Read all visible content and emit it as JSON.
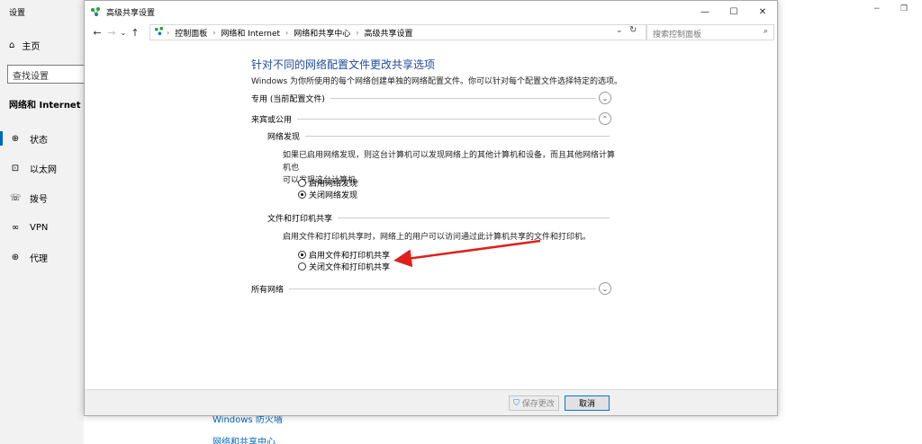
{
  "settings": {
    "title": "设置",
    "home_label": "主页",
    "search_placeholder": "查找设置",
    "section_title": "网络和 Internet",
    "nav": [
      {
        "label": "状态",
        "icon": "status-icon",
        "glyph": "⊕"
      },
      {
        "label": "以太网",
        "icon": "ethernet-icon",
        "glyph": "⊡"
      },
      {
        "label": "拨号",
        "icon": "dialup-icon",
        "glyph": "☏"
      },
      {
        "label": "VPN",
        "icon": "vpn-icon",
        "glyph": "∞"
      },
      {
        "label": "代理",
        "icon": "proxy-icon",
        "glyph": "⊕"
      }
    ],
    "links": [
      "Windows 防火墙",
      "网络和共享中心"
    ],
    "win_minimize": "−",
    "win_restore": "❐"
  },
  "window": {
    "title": "高级共享设置",
    "btn_minimize": "—",
    "btn_maximize": "☐",
    "btn_close": "✕"
  },
  "address": {
    "back": "←",
    "forward": "→",
    "recent": "⌄",
    "up": "↑",
    "crumbs": [
      "控制面板",
      "网络和 Internet",
      "网络和共享中心",
      "高级共享设置"
    ],
    "separator": "›",
    "dropdown": "⌄",
    "refresh": "↻",
    "search_placeholder": "搜索控制面板",
    "search_glyph": "⌕"
  },
  "content": {
    "heading": "针对不同的网络配置文件更改共享选项",
    "subtitle": "Windows 为你所使用的每个网络创建单独的网络配置文件。你可以针对每个配置文件选择特定的选项。",
    "private_profile": "专用 (当前配置文件)",
    "guest_profile": "来宾或公用",
    "all_networks": "所有网络",
    "chevron_down": "⌄",
    "chevron_up": "⌃",
    "discovery": {
      "title": "网络发现",
      "desc_line1": "如果已启用网络发现，则这台计算机可以发现网络上的其他计算机和设备，而且其他网络计算机也",
      "desc_line2": "可以发现这台计算机。",
      "option_on": "启用网络发现",
      "option_off": "关闭网络发现",
      "selected": "off"
    },
    "file_sharing": {
      "title": "文件和打印机共享",
      "desc": "启用文件和打印机共享时，网络上的用户可以访问通过此计算机共享的文件和打印机。",
      "option_on": "启用文件和打印机共享",
      "option_off": "关闭文件和打印机共享",
      "selected": "on"
    }
  },
  "footer": {
    "save_label": "保存更改",
    "save_enabled": false,
    "cancel_label": "取消"
  },
  "annotation": {
    "color": "#e0201c"
  }
}
